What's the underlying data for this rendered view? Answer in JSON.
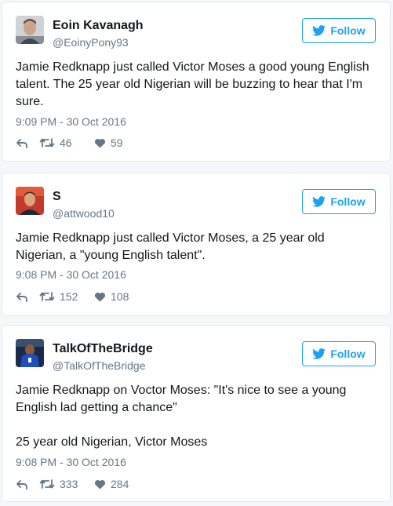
{
  "colors": {
    "accent": "#1da1f2",
    "secondary_text": "#657786",
    "border": "#e1e8ed",
    "background": "#f5f8fa"
  },
  "tweets": [
    {
      "name": "Eoin Kavanagh",
      "handle": "@EoinyPony93",
      "follow_label": "Follow",
      "text": [
        "Jamie Redknapp just called Victor Moses a good young English talent. The 25 year old Nigerian will be buzzing to hear that I'm sure."
      ],
      "timestamp": "9:09 PM - 30 Oct 2016",
      "retweets": "46",
      "likes": "59",
      "icons": [
        "avatar",
        "twitter-bird-icon",
        "reply-icon",
        "retweet-icon",
        "heart-icon"
      ]
    },
    {
      "name": "S",
      "handle": "@attwood10",
      "follow_label": "Follow",
      "text": [
        "Jamie Redknapp just called Victor Moses, a 25 year old Nigerian, a \"young English talent\"."
      ],
      "timestamp": "9:08 PM - 30 Oct 2016",
      "retweets": "152",
      "likes": "108",
      "icons": [
        "avatar",
        "twitter-bird-icon",
        "reply-icon",
        "retweet-icon",
        "heart-icon"
      ]
    },
    {
      "name": "TalkOfTheBridge",
      "handle": "@TalkOfTheBridge",
      "follow_label": "Follow",
      "text": [
        "Jamie Redknapp on Voctor Moses: \"It's nice to see a young English lad getting a chance\"",
        "25 year old Nigerian, Victor Moses"
      ],
      "timestamp": "9:08 PM - 30 Oct 2016",
      "retweets": "333",
      "likes": "284",
      "icons": [
        "avatar",
        "twitter-bird-icon",
        "reply-icon",
        "retweet-icon",
        "heart-icon"
      ]
    }
  ]
}
